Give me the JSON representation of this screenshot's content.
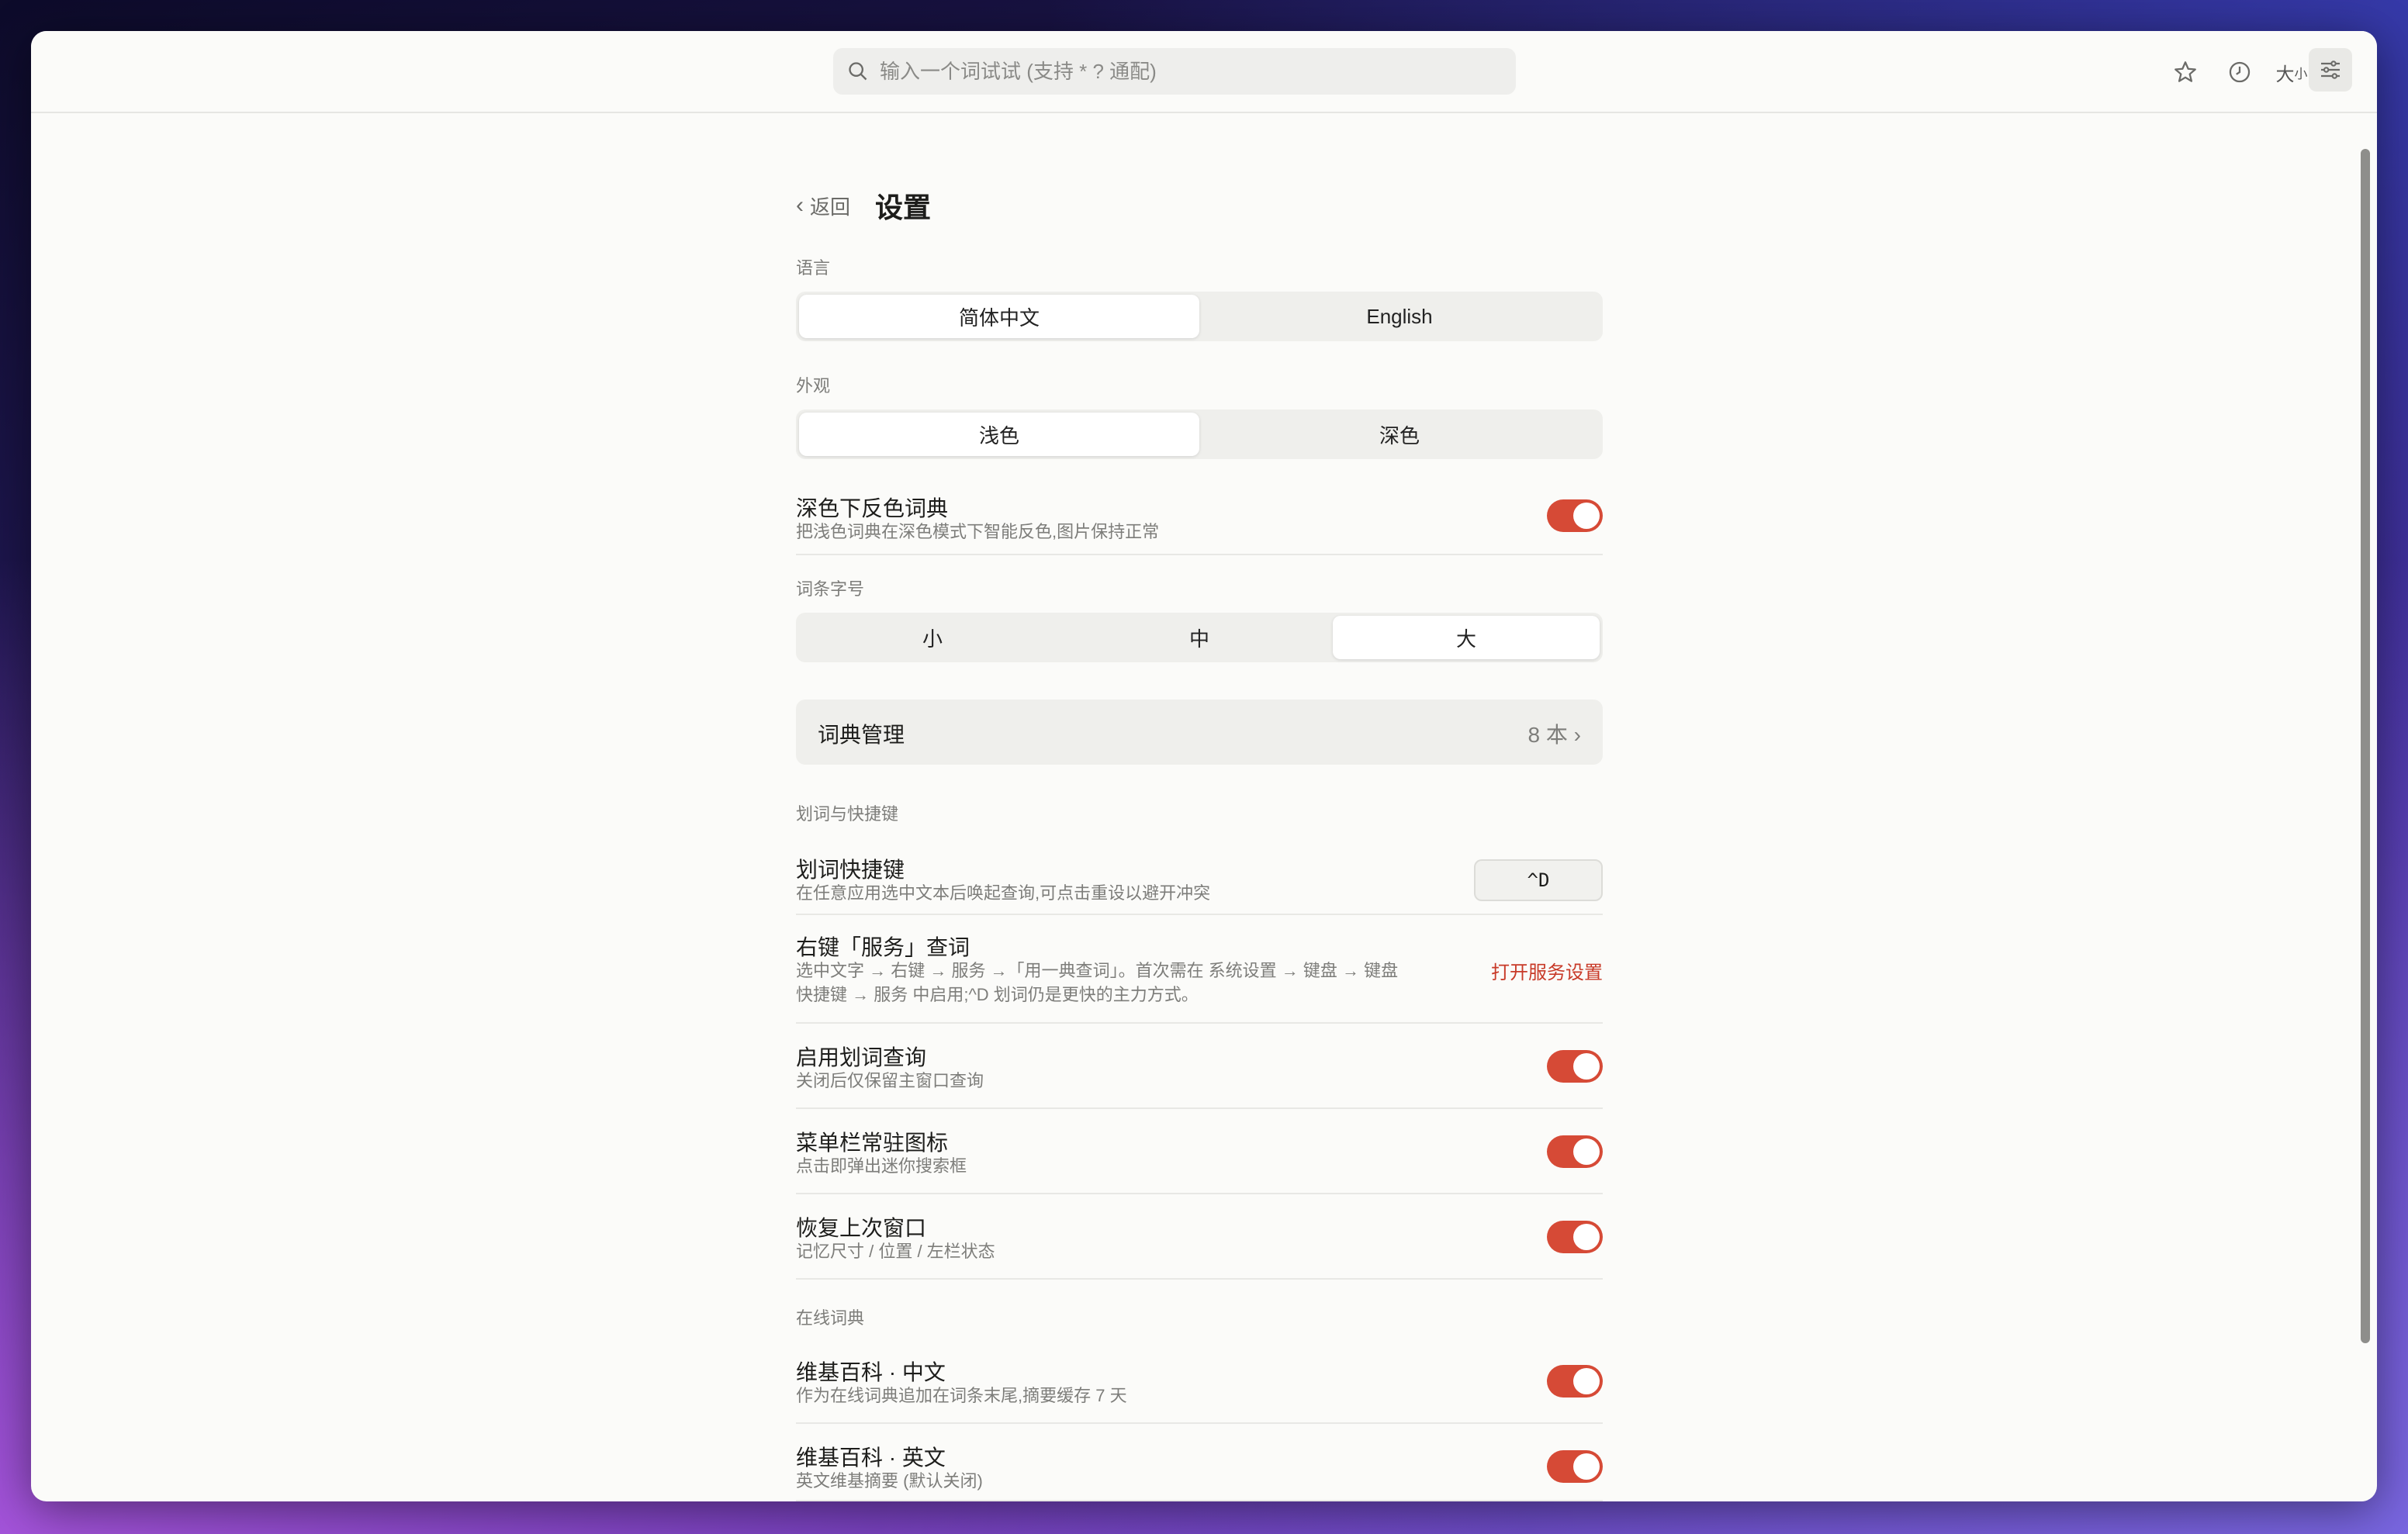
{
  "search": {
    "placeholder": "输入一个词试试 (支持 * ? 通配)"
  },
  "toolbar": {
    "favorites_icon": "star-icon",
    "history_icon": "clock-icon",
    "font_size_big": "大",
    "font_size_small": "小",
    "settings_icon": "sliders-icon"
  },
  "header": {
    "back_label": "返回",
    "title": "设置"
  },
  "language": {
    "label": "语言",
    "options": [
      "简体中文",
      "English"
    ],
    "selected": "简体中文"
  },
  "appearance": {
    "label": "外观",
    "options": [
      "浅色",
      "深色"
    ],
    "selected": "浅色"
  },
  "invert_dark": {
    "title": "深色下反色词典",
    "desc": "把浅色词典在深色模式下智能反色,图片保持正常",
    "enabled": true
  },
  "entry_font_size": {
    "label": "词条字号",
    "options": [
      "小",
      "中",
      "大"
    ],
    "selected": "大"
  },
  "dict_management": {
    "label": "词典管理",
    "count": "8 本 ›"
  },
  "selection_section": {
    "label": "划词与快捷键"
  },
  "shortcut_row": {
    "title": "划词快捷键",
    "desc": "在任意应用选中文本后唤起查询,可点击重设以避开冲突",
    "key": "^D"
  },
  "services_row": {
    "title": "右键「服务」查词",
    "desc_line1": "选中文字 → 右键 → 服务 →「用一典查词」。首次需在 系统设置 → 键盘 → 键盘",
    "desc_line2": "快捷键 → 服务 中启用;^D 划词仍是更快的主力方式。",
    "action": "打开服务设置"
  },
  "enable_selection": {
    "title": "启用划词查询",
    "desc": "关闭后仅保留主窗口查询",
    "enabled": true
  },
  "menubar_icon": {
    "title": "菜单栏常驻图标",
    "desc": "点击即弹出迷你搜索框",
    "enabled": true
  },
  "restore_window": {
    "title": "恢复上次窗口",
    "desc": "记忆尺寸 / 位置 / 左栏状态",
    "enabled": true
  },
  "online_section": {
    "label": "在线词典"
  },
  "wiki_zh": {
    "title": "维基百科 · 中文",
    "desc": "作为在线词典追加在词条末尾,摘要缓存 7 天",
    "enabled": true
  },
  "wiki_en": {
    "title": "维基百科 · 英文",
    "desc": "英文维基摘要 (默认关闭)",
    "enabled": true
  },
  "colors": {
    "accent": "#d64a36",
    "link": "#c83a28"
  }
}
